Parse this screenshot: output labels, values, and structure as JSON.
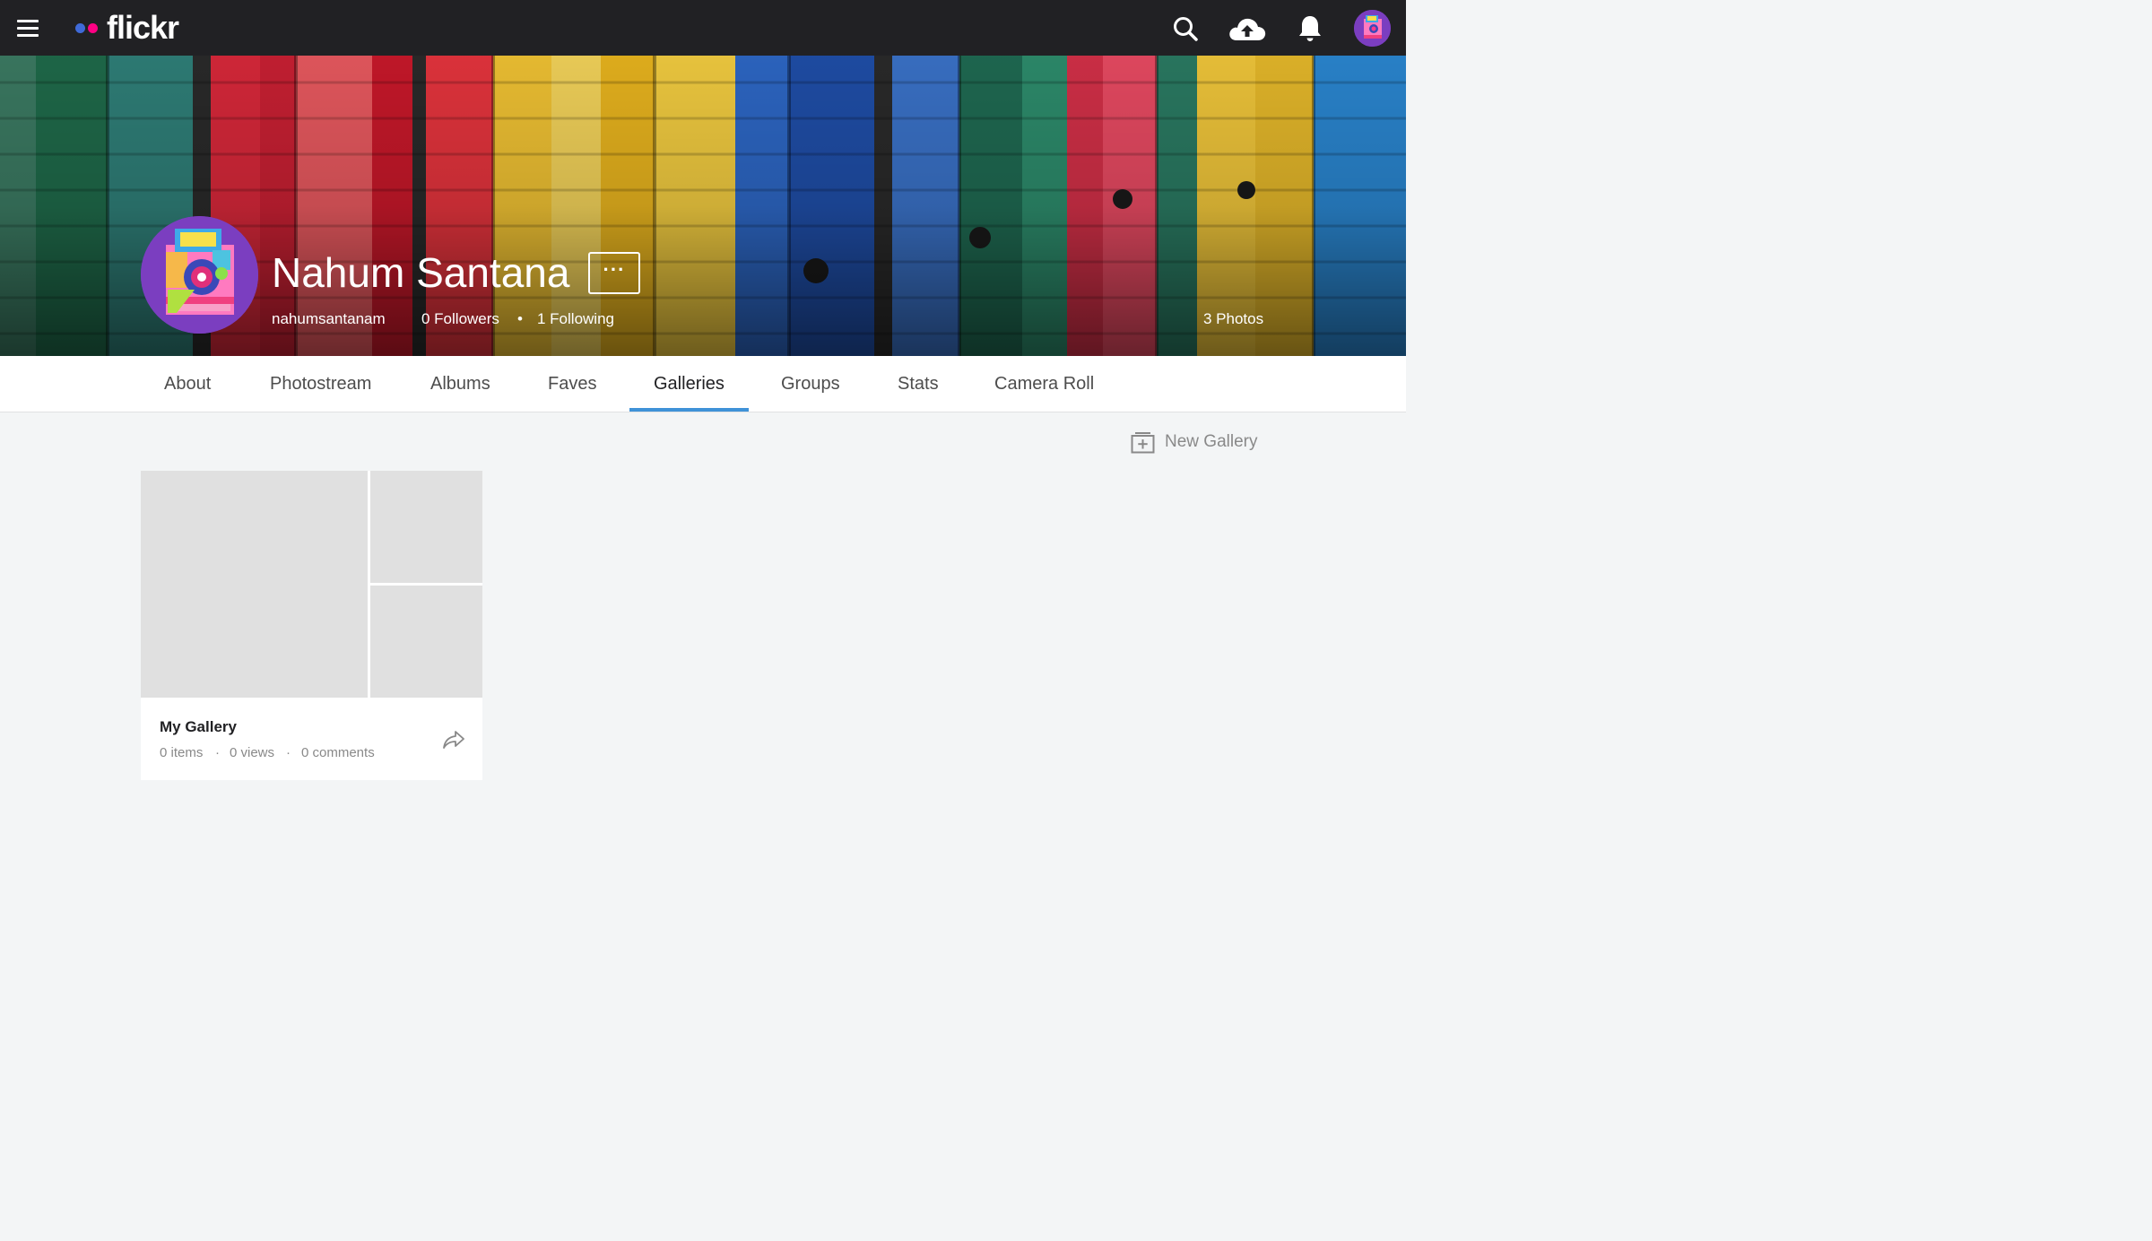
{
  "topbar": {
    "brand": "flickr",
    "icons": [
      "menu-icon",
      "search-icon",
      "upload-cloud-icon",
      "bell-icon",
      "avatar"
    ]
  },
  "profile": {
    "name": "Nahum Santana",
    "username": "nahumsantanam",
    "followers": "0 Followers",
    "following": "1 Following",
    "separator": "•",
    "photos": "3 Photos",
    "more_label": "···"
  },
  "tabs": [
    {
      "label": "About"
    },
    {
      "label": "Photostream"
    },
    {
      "label": "Albums"
    },
    {
      "label": "Faves"
    },
    {
      "label": "Galleries",
      "active": true
    },
    {
      "label": "Groups"
    },
    {
      "label": "Stats"
    },
    {
      "label": "Camera Roll"
    }
  ],
  "actions": {
    "new_gallery": "New Gallery"
  },
  "galleries": [
    {
      "title": "My Gallery",
      "items": "0 items",
      "views": "0 views",
      "comments": "0 comments",
      "separator": "·"
    }
  ],
  "colors": {
    "topbar": "#212124",
    "brand_blue": "#3f6ad8",
    "brand_pink": "#ff0084",
    "active_tab": "#3f92d8",
    "page_bg": "#f3f5f6"
  }
}
